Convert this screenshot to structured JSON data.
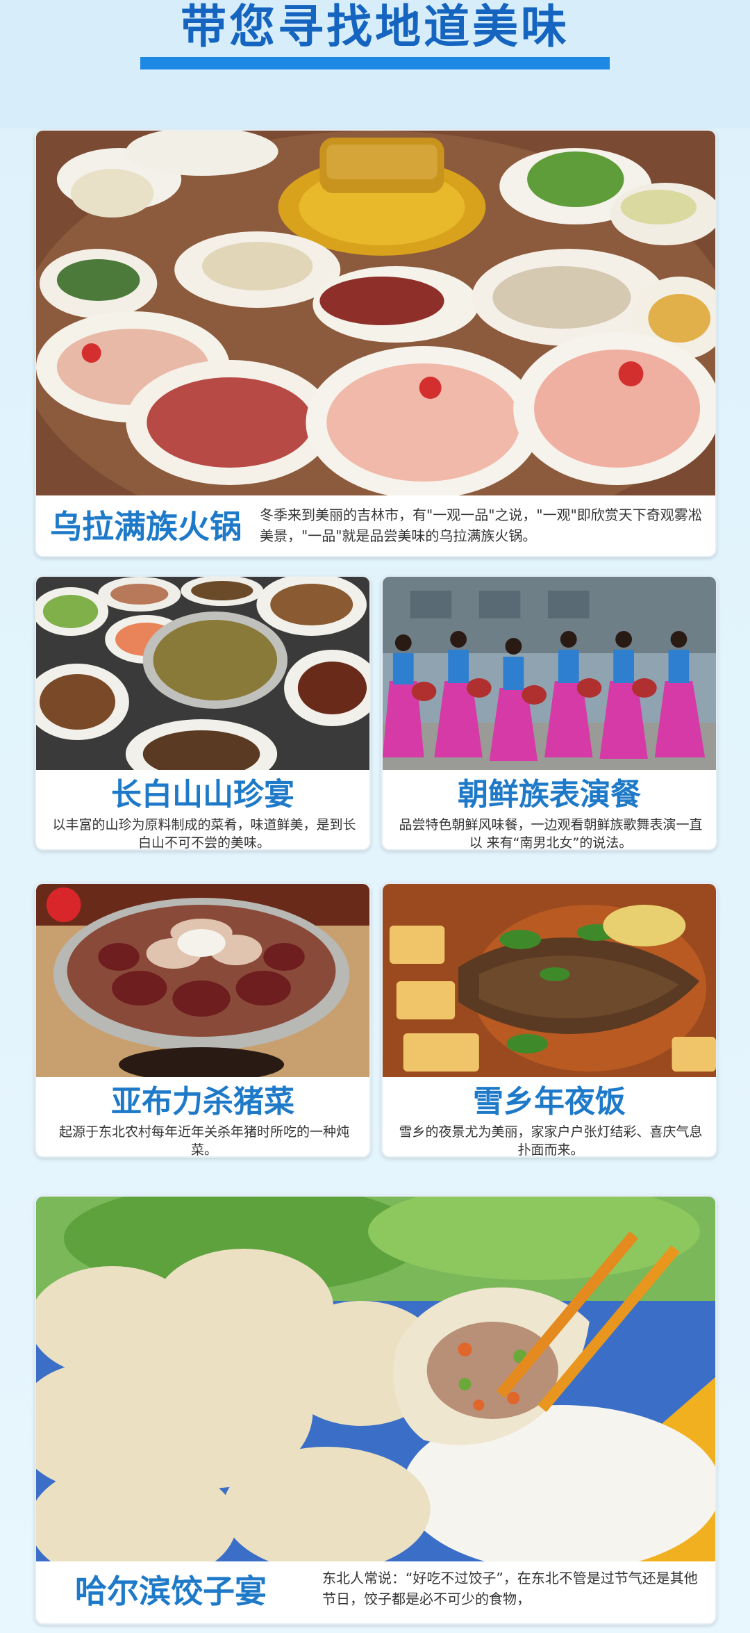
{
  "header": {
    "title": "带您寻找地道美味"
  },
  "cards": [
    {
      "title": "乌拉满族火锅",
      "desc": "冬季来到美丽的吉林市，有\"一观一品\"之说，\"一观\"即欣赏天下奇观雾凇美景，\"一品\"就是品尝美味的乌拉满族火锅。"
    },
    {
      "title": "长白山山珍宴",
      "desc": "以丰富的山珍为原料制成的菜肴，味道鲜美，是到长白山不可不尝的美味。"
    },
    {
      "title": "朝鲜族表演餐",
      "desc": "品尝特色朝鲜风味餐，一边观看朝鲜族歌舞表演一直以 来有“南男北女”的说法。"
    },
    {
      "title": "亚布力杀猪菜",
      "desc": "起源于东北农村每年近年关杀年猪时所吃的一种炖菜。"
    },
    {
      "title": "雪乡年夜饭",
      "desc": "雪乡的夜景尤为美丽，家家户户张灯结彩、喜庆气息扑面而来。"
    },
    {
      "title": "哈尔滨饺子宴",
      "desc": "东北人常说：“好吃不过饺子”，在东北不管是过节气还是其他节日，饺子都是必不可少的食物，"
    }
  ],
  "colors": {
    "title_blue": "#1565c0",
    "accent_blue": "#1e88e5",
    "caption_blue": "#1e7ac8",
    "background": "#d7eefa"
  }
}
